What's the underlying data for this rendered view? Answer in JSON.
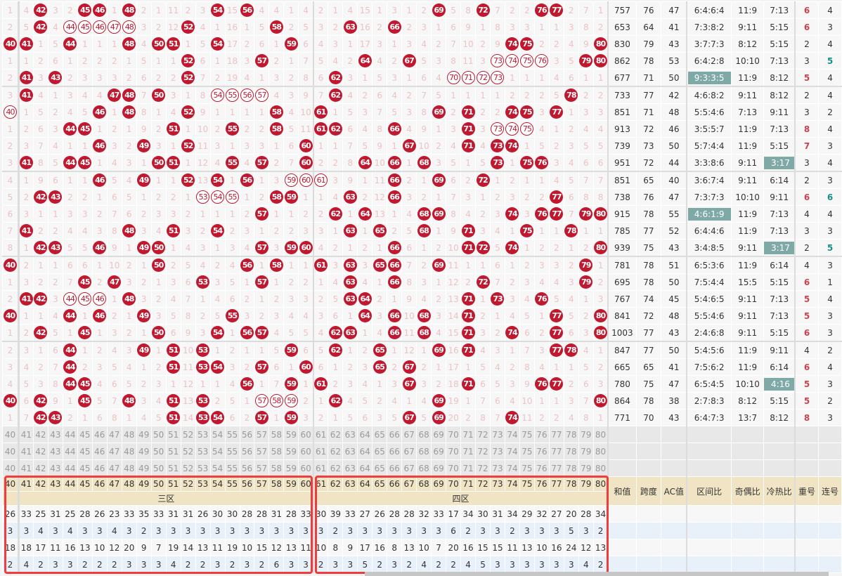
{
  "numbers": [
    40,
    41,
    42,
    43,
    44,
    45,
    46,
    47,
    48,
    49,
    50,
    51,
    52,
    53,
    54,
    55,
    56,
    57,
    58,
    59,
    60,
    61,
    62,
    63,
    64,
    65,
    66,
    67,
    68,
    69,
    70,
    71,
    72,
    73,
    74,
    75,
    76,
    77,
    78,
    79,
    80
  ],
  "stat_headers": [
    "和值",
    "跨度",
    "AC值",
    "区间比",
    "奇偶比",
    "冷热比",
    "重号",
    "连号"
  ],
  "zones": [
    "三区",
    "四区"
  ],
  "colors": {
    "ball": "#c0182f",
    "omission": "#ecc3c3",
    "highlight": "#7fa9a6",
    "repeat_hot": "#d0414f",
    "consec_hot": "#15918a",
    "box": "#f03c3c"
  },
  "rows": [
    [
      1,
      4,
      "b",
      3,
      2,
      "b",
      "b",
      1,
      "b",
      2,
      1,
      11,
      2,
      3,
      "b",
      15,
      "b",
      4,
      4,
      1,
      4,
      2,
      1,
      4,
      15,
      1,
      3,
      1,
      2,
      "b",
      5,
      8,
      "b",
      7,
      2,
      2,
      "b",
      "b",
      2,
      7,
      1
    ],
    [
      2,
      5,
      "b",
      4,
      "o",
      "o",
      "o",
      "o",
      "o",
      3,
      2,
      12,
      "b",
      4,
      1,
      16,
      1,
      5,
      "b",
      2,
      5,
      3,
      2,
      "b",
      16,
      2,
      "b",
      2,
      3,
      1,
      6,
      9,
      1,
      8,
      3,
      3,
      1,
      1,
      3,
      8,
      2
    ],
    [
      "b",
      "b",
      1,
      5,
      "b",
      1,
      1,
      1,
      "b",
      4,
      "b",
      "b",
      1,
      5,
      "b",
      17,
      2,
      6,
      1,
      "b",
      6,
      4,
      3,
      1,
      17,
      3,
      1,
      3,
      4,
      2,
      7,
      10,
      2,
      9,
      "b",
      "b",
      2,
      2,
      4,
      9,
      "b"
    ],
    [
      1,
      1,
      2,
      6,
      1,
      2,
      2,
      2,
      1,
      5,
      1,
      1,
      "b",
      6,
      1,
      18,
      3,
      "b",
      2,
      1,
      7,
      5,
      4,
      2,
      "b",
      4,
      2,
      "b",
      5,
      3,
      8,
      11,
      3,
      "o",
      "o",
      "o",
      "o",
      3,
      5,
      "b",
      "b"
    ],
    [
      2,
      "b",
      3,
      "b",
      2,
      3,
      3,
      3,
      2,
      6,
      2,
      2,
      "b",
      7,
      2,
      19,
      4,
      1,
      3,
      2,
      8,
      6,
      "b",
      3,
      1,
      5,
      3,
      1,
      6,
      4,
      "o",
      "o",
      "o",
      "o",
      1,
      1,
      1,
      4,
      6,
      1,
      1
    ],
    [
      3,
      "b",
      4,
      1,
      3,
      4,
      4,
      "b",
      "b",
      7,
      "b",
      3,
      1,
      8,
      "o",
      "o",
      "o",
      "o",
      4,
      3,
      9,
      7,
      "b",
      4,
      2,
      6,
      4,
      2,
      7,
      5,
      1,
      1,
      1,
      1,
      2,
      2,
      2,
      5,
      "b",
      2,
      2
    ],
    [
      "o",
      1,
      5,
      2,
      4,
      5,
      "b",
      1,
      "b",
      8,
      1,
      4,
      "b",
      9,
      1,
      1,
      1,
      1,
      "b",
      4,
      10,
      "b",
      1,
      5,
      3,
      7,
      5,
      3,
      8,
      "b",
      2,
      "b",
      2,
      2,
      "b",
      "b",
      3,
      "b",
      1,
      3,
      3
    ],
    [
      1,
      2,
      6,
      3,
      "b",
      "b",
      1,
      2,
      1,
      9,
      2,
      "b",
      1,
      10,
      2,
      "b",
      2,
      2,
      "b",
      5,
      11,
      "b",
      "b",
      6,
      4,
      8,
      "b",
      4,
      9,
      1,
      3,
      "b",
      3,
      "o",
      "o",
      "o",
      4,
      1,
      2,
      4,
      4
    ],
    [
      2,
      3,
      7,
      4,
      1,
      1,
      "b",
      3,
      2,
      "b",
      3,
      1,
      "b",
      11,
      3,
      1,
      3,
      3,
      1,
      6,
      "b",
      1,
      1,
      7,
      5,
      9,
      1,
      "b",
      10,
      2,
      4,
      "b",
      4,
      "b",
      "b",
      1,
      5,
      2,
      3,
      5,
      5
    ],
    [
      3,
      "b",
      8,
      5,
      "b",
      "b",
      1,
      4,
      3,
      1,
      "b",
      "b",
      1,
      12,
      4,
      "b",
      4,
      "b",
      2,
      7,
      "b",
      2,
      2,
      8,
      "b",
      10,
      "b",
      1,
      "b",
      3,
      5,
      1,
      5,
      "b",
      1,
      "b",
      "b",
      3,
      4,
      6,
      6
    ],
    [
      4,
      1,
      9,
      6,
      1,
      1,
      "b",
      5,
      4,
      "b",
      1,
      1,
      "b",
      13,
      "b",
      1,
      "b",
      1,
      3,
      "o",
      "o",
      "o",
      3,
      9,
      1,
      11,
      "b",
      2,
      1,
      "b",
      6,
      2,
      "b",
      1,
      2,
      1,
      1,
      4,
      5,
      7,
      7
    ],
    [
      5,
      2,
      "b",
      "b",
      2,
      2,
      1,
      6,
      5,
      1,
      2,
      2,
      1,
      "o",
      "o",
      "o",
      1,
      2,
      "b",
      "b",
      1,
      1,
      4,
      "b",
      2,
      12,
      "b",
      3,
      2,
      1,
      7,
      3,
      1,
      2,
      3,
      2,
      2,
      "b",
      6,
      8,
      8
    ],
    [
      6,
      3,
      1,
      1,
      3,
      3,
      2,
      7,
      6,
      2,
      3,
      3,
      2,
      1,
      1,
      1,
      2,
      "b",
      1,
      1,
      2,
      2,
      "b",
      1,
      "b",
      13,
      1,
      4,
      "b",
      "b",
      8,
      4,
      2,
      3,
      "b",
      3,
      "b",
      "b",
      7,
      "b",
      "b"
    ],
    [
      7,
      "b",
      2,
      2,
      4,
      4,
      3,
      8,
      "b",
      3,
      4,
      "b",
      3,
      2,
      "b",
      2,
      3,
      1,
      2,
      2,
      3,
      3,
      1,
      "b",
      1,
      "b",
      2,
      5,
      "b",
      1,
      9,
      "b",
      3,
      4,
      1,
      "b",
      1,
      1,
      "b",
      1,
      1
    ],
    [
      8,
      1,
      "b",
      "b",
      5,
      5,
      "b",
      9,
      1,
      "b",
      "b",
      1,
      4,
      3,
      1,
      3,
      4,
      "b",
      3,
      "b",
      "b",
      4,
      2,
      1,
      2,
      1,
      "b",
      6,
      1,
      2,
      10,
      "b",
      "b",
      5,
      "b",
      1,
      2,
      2,
      1,
      2,
      "b"
    ],
    [
      "b",
      2,
      1,
      1,
      6,
      6,
      1,
      10,
      2,
      1,
      "b",
      2,
      5,
      4,
      2,
      4,
      "b",
      1,
      "b",
      1,
      1,
      "b",
      3,
      "b",
      3,
      "b",
      "b",
      7,
      2,
      "b",
      11,
      1,
      1,
      6,
      1,
      2,
      3,
      3,
      2,
      "b",
      1
    ],
    [
      1,
      3,
      2,
      2,
      7,
      "b",
      2,
      "b",
      3,
      2,
      1,
      3,
      6,
      "b",
      3,
      5,
      1,
      "b",
      1,
      2,
      2,
      1,
      4,
      "b",
      4,
      1,
      "b",
      8,
      3,
      1,
      12,
      2,
      "b",
      7,
      2,
      3,
      4,
      4,
      3,
      "b",
      2
    ],
    [
      2,
      "b",
      "b",
      3,
      "o",
      "o",
      "o",
      1,
      "b",
      3,
      2,
      4,
      7,
      1,
      4,
      6,
      2,
      1,
      2,
      3,
      3,
      2,
      5,
      "b",
      "b",
      2,
      1,
      9,
      4,
      2,
      13,
      "b",
      1,
      "b",
      3,
      4,
      "b",
      5,
      4,
      1,
      3
    ],
    [
      "b",
      1,
      1,
      4,
      "b",
      1,
      "b",
      2,
      1,
      "b",
      3,
      5,
      8,
      2,
      5,
      "b",
      3,
      2,
      3,
      4,
      4,
      3,
      6,
      1,
      "b",
      3,
      "b",
      10,
      "b",
      3,
      14,
      "b",
      2,
      1,
      4,
      5,
      1,
      "b",
      5,
      2,
      "b"
    ],
    [
      1,
      2,
      "b",
      5,
      1,
      "b",
      1,
      3,
      2,
      1,
      "b",
      6,
      9,
      3,
      "b",
      1,
      "b",
      "b",
      4,
      5,
      5,
      4,
      "b",
      "b",
      1,
      4,
      "b",
      11,
      "b",
      4,
      15,
      "b",
      3,
      2,
      "b",
      6,
      2,
      "b",
      6,
      3,
      "b"
    ],
    [
      2,
      3,
      1,
      6,
      "b",
      1,
      2,
      4,
      3,
      "b",
      1,
      "b",
      10,
      "b",
      1,
      2,
      1,
      1,
      5,
      "b",
      6,
      5,
      "b",
      1,
      2,
      "b",
      1,
      12,
      1,
      "b",
      16,
      "b",
      4,
      3,
      1,
      7,
      3,
      "b",
      "b",
      4,
      1
    ],
    [
      3,
      4,
      2,
      7,
      "b",
      2,
      3,
      5,
      4,
      1,
      2,
      "b",
      11,
      "b",
      "b",
      3,
      2,
      "b",
      6,
      1,
      "b",
      6,
      1,
      2,
      3,
      "b",
      2,
      "b",
      2,
      1,
      17,
      1,
      5,
      4,
      2,
      8,
      4,
      1,
      1,
      5,
      2
    ],
    [
      4,
      5,
      3,
      8,
      "b",
      "b",
      4,
      6,
      5,
      2,
      3,
      1,
      12,
      1,
      1,
      4,
      "b",
      1,
      7,
      "b",
      1,
      "b",
      2,
      3,
      4,
      1,
      3,
      "b",
      3,
      2,
      18,
      "b",
      6,
      5,
      3,
      9,
      "b",
      "b",
      2,
      6,
      3
    ],
    [
      "b",
      6,
      "b",
      9,
      1,
      "b",
      5,
      7,
      "b",
      3,
      4,
      "b",
      13,
      "b",
      2,
      5,
      1,
      "o",
      "o",
      "o",
      2,
      1,
      "b",
      4,
      5,
      2,
      4,
      1,
      4,
      "b",
      19,
      1,
      7,
      6,
      4,
      10,
      1,
      1,
      3,
      7,
      "b"
    ],
    [
      1,
      7,
      "b",
      "b",
      2,
      1,
      6,
      8,
      1,
      4,
      5,
      "b",
      14,
      "b",
      "b",
      6,
      2,
      "b",
      1,
      "b",
      3,
      2,
      1,
      5,
      6,
      3,
      5,
      "b",
      5,
      "b",
      20,
      2,
      8,
      7,
      "b",
      11,
      2,
      2,
      4,
      8,
      1
    ]
  ],
  "stats": [
    {
      "sum": "757",
      "span": "76",
      "ac": "47",
      "zone": "6:4:6:4",
      "oe": "11:9",
      "ch": "7:13",
      "rep": "6",
      "con": "4",
      "hl": ""
    },
    {
      "sum": "653",
      "span": "64",
      "ac": "41",
      "zone": "7:3:8:2",
      "oe": "9:11",
      "ch": "5:15",
      "rep": "6",
      "con": "3",
      "hl": ""
    },
    {
      "sum": "830",
      "span": "79",
      "ac": "43",
      "zone": "3:7:7:3",
      "oe": "8:12",
      "ch": "5:15",
      "rep": "2",
      "con": "4",
      "hl": ""
    },
    {
      "sum": "862",
      "span": "78",
      "ac": "53",
      "zone": "6:4:2:8",
      "oe": "10:10",
      "ch": "7:13",
      "rep": "3",
      "con": "5",
      "hl": ""
    },
    {
      "sum": "677",
      "span": "71",
      "ac": "50",
      "zone": "9:3:3:5",
      "oe": "11:9",
      "ch": "8:12",
      "rep": "5",
      "con": "4",
      "hl": "zone"
    },
    {
      "sum": "733",
      "span": "77",
      "ac": "42",
      "zone": "4:6:8:2",
      "oe": "9:11",
      "ch": "8:12",
      "rep": "2",
      "con": "4",
      "hl": ""
    },
    {
      "sum": "851",
      "span": "71",
      "ac": "48",
      "zone": "5:5:4:6",
      "oe": "7:13",
      "ch": "9:11",
      "rep": "3",
      "con": "2",
      "hl": ""
    },
    {
      "sum": "913",
      "span": "72",
      "ac": "46",
      "zone": "3:5:5:7",
      "oe": "11:9",
      "ch": "7:13",
      "rep": "8",
      "con": "4",
      "hl": ""
    },
    {
      "sum": "739",
      "span": "73",
      "ac": "50",
      "zone": "5:7:4:4",
      "oe": "11:9",
      "ch": "5:15",
      "rep": "7",
      "con": "3",
      "hl": ""
    },
    {
      "sum": "951",
      "span": "72",
      "ac": "44",
      "zone": "3:3:8:6",
      "oe": "9:11",
      "ch": "3:17",
      "rep": "3",
      "con": "4",
      "hl": "ch"
    },
    {
      "sum": "851",
      "span": "65",
      "ac": "40",
      "zone": "3:6:7:4",
      "oe": "9:11",
      "ch": "6:14",
      "rep": "2",
      "con": "3",
      "hl": ""
    },
    {
      "sum": "738",
      "span": "76",
      "ac": "47",
      "zone": "7:3:7:3",
      "oe": "10:10",
      "ch": "9:11",
      "rep": "6",
      "con": "6",
      "hl": ""
    },
    {
      "sum": "915",
      "span": "78",
      "ac": "55",
      "zone": "4:6:1:9",
      "oe": "11:9",
      "ch": "7:13",
      "rep": "4",
      "con": "4",
      "hl": "zone"
    },
    {
      "sum": "785",
      "span": "77",
      "ac": "52",
      "zone": "6:4:4:6",
      "oe": "11:9",
      "ch": "7:13",
      "rep": "3",
      "con": "3",
      "hl": ""
    },
    {
      "sum": "939",
      "span": "75",
      "ac": "43",
      "zone": "3:4:8:5",
      "oe": "9:11",
      "ch": "3:17",
      "rep": "2",
      "con": "5",
      "hl": "ch"
    },
    {
      "sum": "781",
      "span": "78",
      "ac": "51",
      "zone": "6:5:3:6",
      "oe": "11:9",
      "ch": "6:14",
      "rep": "4",
      "con": "3",
      "hl": ""
    },
    {
      "sum": "695",
      "span": "78",
      "ac": "50",
      "zone": "7:5:4:4",
      "oe": "15:5",
      "ch": "5:15",
      "rep": "6",
      "con": "1",
      "hl": ""
    },
    {
      "sum": "767",
      "span": "74",
      "ac": "45",
      "zone": "5:4:6:5",
      "oe": "9:11",
      "ch": "7:13",
      "rep": "5",
      "con": "4",
      "hl": ""
    },
    {
      "sum": "841",
      "span": "72",
      "ac": "48",
      "zone": "5:5:4:6",
      "oe": "9:11",
      "ch": "7:13",
      "rep": "5",
      "con": "3",
      "hl": ""
    },
    {
      "sum": "1003",
      "span": "77",
      "ac": "43",
      "zone": "2:4:6:8",
      "oe": "9:11",
      "ch": "5:15",
      "rep": "6",
      "con": "3",
      "hl": ""
    },
    {
      "sum": "847",
      "span": "77",
      "ac": "50",
      "zone": "5:4:5:6",
      "oe": "11:9",
      "ch": "9:11",
      "rep": "4",
      "con": "2",
      "hl": ""
    },
    {
      "sum": "665",
      "span": "65",
      "ac": "41",
      "zone": "7:5:6:2",
      "oe": "11:9",
      "ch": "6:14",
      "rep": "6",
      "con": "4",
      "hl": ""
    },
    {
      "sum": "780",
      "span": "75",
      "ac": "47",
      "zone": "6:5:4:5",
      "oe": "10:10",
      "ch": "4:16",
      "rep": "5",
      "con": "3",
      "hl": "ch"
    },
    {
      "sum": "864",
      "span": "78",
      "ac": "38",
      "zone": "2:7:8:3",
      "oe": "8:12",
      "ch": "5:15",
      "rep": "5",
      "con": "2",
      "hl": ""
    },
    {
      "sum": "771",
      "span": "70",
      "ac": "43",
      "zone": "6:4:7:3",
      "oe": "13:7",
      "ch": "8:12",
      "rep": "8",
      "con": "3",
      "hl": ""
    }
  ],
  "summary_rows": [
    [
      26,
      33,
      25,
      31,
      25,
      28,
      26,
      23,
      33,
      35,
      33,
      31,
      31,
      26,
      30,
      30,
      28,
      28,
      31,
      28,
      33,
      30,
      39,
      33,
      27,
      26,
      28,
      28,
      32,
      33,
      17,
      34,
      30,
      31,
      34,
      29,
      32,
      27,
      20,
      28,
      34
    ],
    [
      3,
      3,
      4,
      3,
      4,
      3,
      3,
      4,
      3,
      2,
      3,
      3,
      3,
      3,
      3,
      3,
      3,
      3,
      3,
      3,
      3,
      3,
      2,
      3,
      3,
      3,
      3,
      3,
      3,
      3,
      6,
      2,
      3,
      3,
      2,
      3,
      3,
      3,
      5,
      3,
      2
    ],
    [
      18,
      18,
      17,
      11,
      16,
      13,
      10,
      12,
      20,
      9,
      7,
      19,
      14,
      13,
      11,
      19,
      10,
      15,
      12,
      13,
      11,
      10,
      8,
      9,
      17,
      16,
      8,
      13,
      10,
      7,
      20,
      16,
      15,
      15,
      11,
      13,
      10,
      16,
      24,
      12,
      13
    ],
    [
      2,
      4,
      2,
      3,
      3,
      2,
      2,
      2,
      3,
      3,
      3,
      4,
      2,
      2,
      3,
      2,
      3,
      2,
      6,
      3,
      3,
      2,
      3,
      3,
      5,
      2,
      3,
      2,
      4,
      2,
      2,
      4,
      5,
      3,
      3,
      3,
      3,
      3,
      3,
      4,
      2
    ]
  ]
}
